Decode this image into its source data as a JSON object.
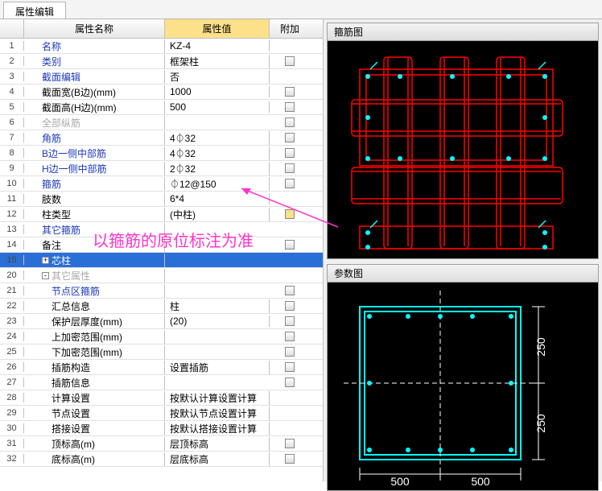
{
  "tab": "属性编辑",
  "headers": {
    "name": "属性名称",
    "value": "属性值",
    "extra": "附加"
  },
  "rows": [
    {
      "n": "1",
      "name": "名称",
      "val": "KZ-4",
      "link": true,
      "chk": false
    },
    {
      "n": "2",
      "name": "类别",
      "val": "框架柱",
      "link": true,
      "chk": true
    },
    {
      "n": "3",
      "name": "截面编辑",
      "val": "否",
      "link": true,
      "chk": false
    },
    {
      "n": "4",
      "name": "截面宽(B边)(mm)",
      "val": "1000",
      "chk": true
    },
    {
      "n": "5",
      "name": "截面高(H边)(mm)",
      "val": "500",
      "chk": true
    },
    {
      "n": "6",
      "name": "全部纵筋",
      "val": "",
      "gray": true,
      "chk": true
    },
    {
      "n": "7",
      "name": "角筋",
      "val": "4⏀32",
      "link": true,
      "chk": true
    },
    {
      "n": "8",
      "name": "B边一侧中部筋",
      "val": "4⏀32",
      "link": true,
      "chk": true
    },
    {
      "n": "9",
      "name": "H边一侧中部筋",
      "val": "2⏀32",
      "link": true,
      "chk": true
    },
    {
      "n": "10",
      "name": "箍筋",
      "val": "⏀12@150",
      "link": true,
      "chk": true
    },
    {
      "n": "11",
      "name": "肢数",
      "val": "6*4",
      "chk": false
    },
    {
      "n": "12",
      "name": "柱类型",
      "val": "(中柱)",
      "chk": true,
      "chkgold": true
    },
    {
      "n": "13",
      "name": "其它箍筋",
      "val": "",
      "link": true,
      "chk": false
    },
    {
      "n": "14",
      "name": "备注",
      "val": "",
      "chk": true
    },
    {
      "n": "15",
      "name": "芯柱",
      "val": "",
      "exp": "+",
      "sel": true
    },
    {
      "n": "20",
      "name": "其它属性",
      "val": "",
      "exp": "-",
      "gray": true
    },
    {
      "n": "21",
      "name": "节点区箍筋",
      "val": "",
      "link": true,
      "chk": true,
      "indent": 2
    },
    {
      "n": "22",
      "name": "汇总信息",
      "val": "柱",
      "chk": true,
      "indent": 2
    },
    {
      "n": "23",
      "name": "保护层厚度(mm)",
      "val": "(20)",
      "chk": true,
      "indent": 2
    },
    {
      "n": "24",
      "name": "上加密范围(mm)",
      "val": "",
      "chk": true,
      "indent": 2
    },
    {
      "n": "25",
      "name": "下加密范围(mm)",
      "val": "",
      "chk": true,
      "indent": 2
    },
    {
      "n": "26",
      "name": "插筋构造",
      "val": "设置插筋",
      "chk": true,
      "indent": 2
    },
    {
      "n": "27",
      "name": "插筋信息",
      "val": "",
      "chk": true,
      "indent": 2
    },
    {
      "n": "28",
      "name": "计算设置",
      "val": "按默认计算设置计算",
      "indent": 2
    },
    {
      "n": "29",
      "name": "节点设置",
      "val": "按默认节点设置计算",
      "indent": 2
    },
    {
      "n": "30",
      "name": "搭接设置",
      "val": "按默认搭接设置计算",
      "indent": 2
    },
    {
      "n": "31",
      "name": "顶标高(m)",
      "val": "层顶标高",
      "chk": true,
      "indent": 2
    },
    {
      "n": "32",
      "name": "底标高(m)",
      "val": "层底标高",
      "chk": true,
      "indent": 2
    }
  ],
  "panel1": "箍筋图",
  "panel2": "参数图",
  "dims": {
    "w1": "500",
    "w2": "500",
    "h1": "250",
    "h2": "250"
  },
  "annotation": "以箍筋的原位标注为准"
}
